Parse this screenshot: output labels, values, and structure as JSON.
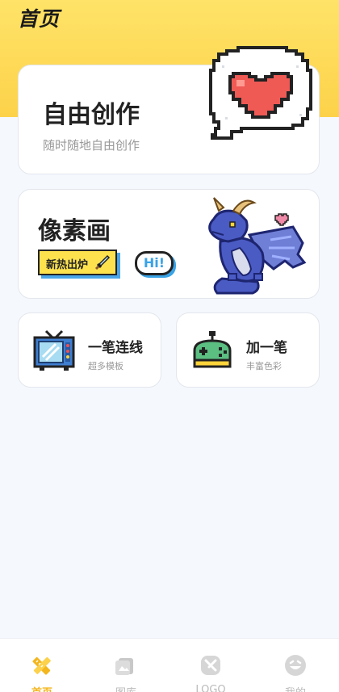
{
  "header": {
    "title": "首页"
  },
  "cards": {
    "create": {
      "title": "自由创作",
      "subtitle": "随时随地自由创作"
    },
    "pixel": {
      "title": "像素画",
      "hot_tag": "新热出炉",
      "bubble": "Hi!"
    },
    "line": {
      "title": "一笔连线",
      "subtitle": "超多模板"
    },
    "add": {
      "title": "加一笔",
      "subtitle": "丰富色彩"
    }
  },
  "tabbar": {
    "items": [
      {
        "label": "首页",
        "icon": "pencil-ruler-icon"
      },
      {
        "label": "图库",
        "icon": "gallery-icon"
      },
      {
        "label": "LOGO",
        "icon": "logo-icon"
      },
      {
        "label": "我的",
        "icon": "smiley-icon"
      }
    ],
    "active_color": "#f3b61d"
  },
  "colors": {
    "accent": "#fdd24a"
  }
}
